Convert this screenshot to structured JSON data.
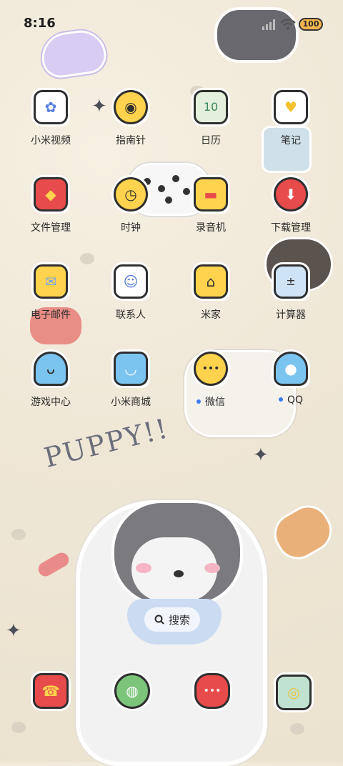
{
  "status": {
    "time": "8:16",
    "battery": "100"
  },
  "apps": [
    {
      "label": "小米视频",
      "icon": "video-icon",
      "color": "#ffffff",
      "accent": "#5a7fe0"
    },
    {
      "label": "指南针",
      "icon": "compass-icon",
      "color": "#ffd34d",
      "accent": "#2f2f2f"
    },
    {
      "label": "日历",
      "icon": "calendar-icon",
      "color": "#e4f0dc",
      "accent": "#3a8a5a",
      "glyph": "10"
    },
    {
      "label": "笔记",
      "icon": "notes-icon",
      "color": "#ffffff",
      "accent": "#f1c12e"
    },
    {
      "label": "文件管理",
      "icon": "folder-icon",
      "color": "#e84b4b",
      "accent": "#ffd34d"
    },
    {
      "label": "时钟",
      "icon": "clock-icon",
      "color": "#ffd34d",
      "accent": "#2f2f2f"
    },
    {
      "label": "录音机",
      "icon": "recorder-icon",
      "color": "#ffd34d",
      "accent": "#e84b4b"
    },
    {
      "label": "下载管理",
      "icon": "download-icon",
      "color": "#e84b4b",
      "accent": "#ffffff"
    },
    {
      "label": "电子邮件",
      "icon": "mail-icon",
      "color": "#ffd34d",
      "accent": "#7aa5e0"
    },
    {
      "label": "联系人",
      "icon": "contacts-icon",
      "color": "#ffffff",
      "accent": "#5a7fe0"
    },
    {
      "label": "米家",
      "icon": "home-icon",
      "color": "#ffd34d",
      "accent": "#2f2f2f"
    },
    {
      "label": "计算器",
      "icon": "calculator-icon",
      "color": "#cfe3f7",
      "accent": "#2f2f2f"
    },
    {
      "label": "游戏中心",
      "icon": "game-octopus-icon",
      "color": "#7cc4f0",
      "accent": "#2f2f2f"
    },
    {
      "label": "小米商城",
      "icon": "shop-bag-icon",
      "color": "#7cc4f0",
      "accent": "#ffffff"
    },
    {
      "label": "微信",
      "icon": "wechat-icon",
      "color": "#ffd34d",
      "accent": "#ffffff",
      "dot": true
    },
    {
      "label": "QQ",
      "icon": "qq-penguin-icon",
      "color": "#7cc4f0",
      "accent": "#ffffff",
      "dot": true
    }
  ],
  "search": {
    "label": "搜索"
  },
  "dock": [
    {
      "icon": "phone-icon",
      "color": "#e84b4b"
    },
    {
      "icon": "browser-planet-icon",
      "color": "#7cc47a"
    },
    {
      "icon": "messages-icon",
      "color": "#e84b4b"
    },
    {
      "icon": "camera-icon",
      "color": "#bfe3d0"
    }
  ],
  "decor": {
    "text": "PUPPY!!"
  }
}
